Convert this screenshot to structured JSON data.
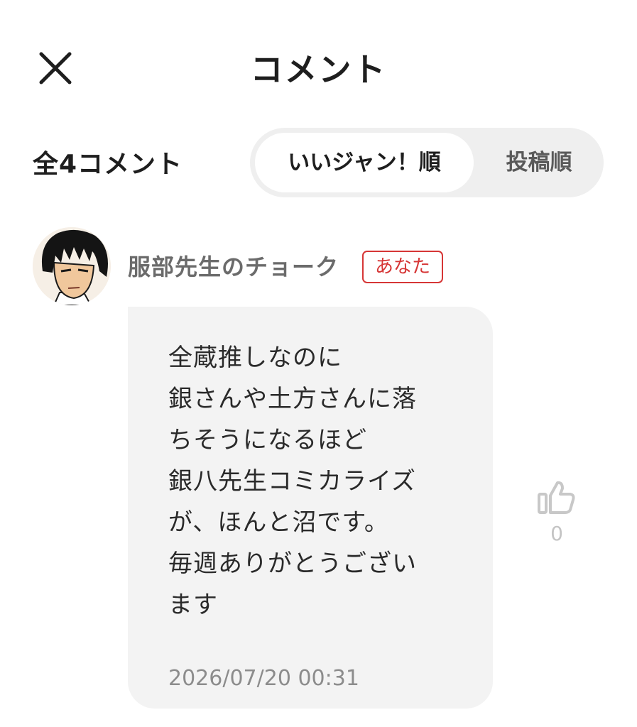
{
  "header": {
    "title": "コメント",
    "close_icon": "close-icon"
  },
  "summary": {
    "count_label": "全4コメント"
  },
  "sort": {
    "options": [
      "いいジャン！順",
      "投稿順"
    ],
    "selected": "いいジャン！順"
  },
  "comments": [
    {
      "username": "服部先生のチョーク",
      "badge": "あなた",
      "lines": [
        "全蔵推しなのに",
        "銀さんや土方さんに落",
        "ちそうになるほど",
        "銀八先生コミカライズ",
        "が、ほんと沼です。",
        "毎週ありがとうござい",
        "ます"
      ],
      "timestamp": "2026/07/20 00:31",
      "likes": "0",
      "like_icon": "thumbs-up-icon"
    }
  ],
  "colors": {
    "badge_red": "#d63636",
    "toggle_bg": "#efefef",
    "bubble_bg": "#f3f3f3"
  }
}
